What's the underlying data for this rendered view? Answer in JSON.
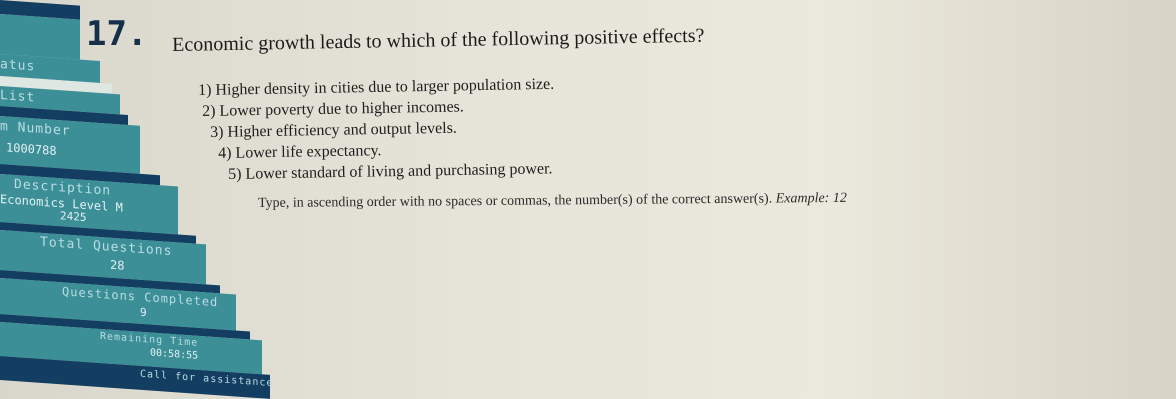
{
  "question": {
    "number": "17.",
    "text": "Economic growth leads to which of the following positive effects?",
    "options": [
      "1) Higher density in cities due to larger population size.",
      "2) Lower poverty due to higher incomes.",
      "3) Higher efficiency and output levels.",
      "4) Lower life expectancy.",
      "5) Lower standard of living and purchasing power."
    ],
    "instruction": "Type, in ascending order with no spaces or commas, the number(s) of the correct answer(s).",
    "example": "Example: 12"
  },
  "sidebar": {
    "status_label": "atus",
    "list_label": "List",
    "item_number_label": "m Number",
    "item_number_value": "1000788",
    "description_label": "Description",
    "description_value_line1": "Economics Level M",
    "description_value_line2": "2425",
    "total_questions_label": "Total Questions",
    "total_questions_value": "28",
    "questions_completed_label": "Questions Completed",
    "questions_completed_value": "9",
    "remaining_time_label": "Remaining Time",
    "remaining_time_value": "00:58:55",
    "call_assistance_label": "Call for assistance"
  },
  "colors": {
    "sidebar_teal": "#3c8f97",
    "sidebar_navy": "#133e61",
    "text_dark": "#1b1b1b"
  }
}
